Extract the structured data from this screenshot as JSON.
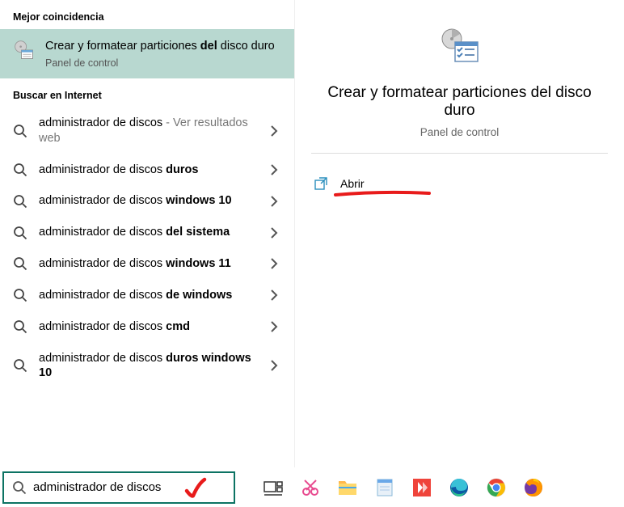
{
  "left": {
    "section_best": "Mejor coincidencia",
    "best_match": {
      "title_pre": "Crear y formatear particiones ",
      "title_bold": "del",
      "title_post": " disco duro",
      "subtitle": "Panel de control"
    },
    "section_internet": "Buscar en Internet",
    "suggestions": [
      {
        "pre": "administrador de discos",
        "bold": "",
        "post": "",
        "sub": " - Ver resultados web"
      },
      {
        "pre": "administrador de discos ",
        "bold": "duros",
        "post": "",
        "sub": ""
      },
      {
        "pre": "administrador de discos ",
        "bold": "windows 10",
        "post": "",
        "sub": ""
      },
      {
        "pre": "administrador de discos ",
        "bold": "del sistema",
        "post": "",
        "sub": ""
      },
      {
        "pre": "administrador de discos ",
        "bold": "windows 11",
        "post": "",
        "sub": ""
      },
      {
        "pre": "administrador de discos ",
        "bold": "de windows",
        "post": "",
        "sub": ""
      },
      {
        "pre": "administrador de discos ",
        "bold": "cmd",
        "post": "",
        "sub": ""
      },
      {
        "pre": "administrador de discos ",
        "bold": "duros windows 10",
        "post": "",
        "sub": ""
      }
    ]
  },
  "right": {
    "title": "Crear y formatear particiones del disco duro",
    "subtitle": "Panel de control",
    "action_open": "Abrir"
  },
  "taskbar": {
    "search_value": "administrador de discos"
  }
}
